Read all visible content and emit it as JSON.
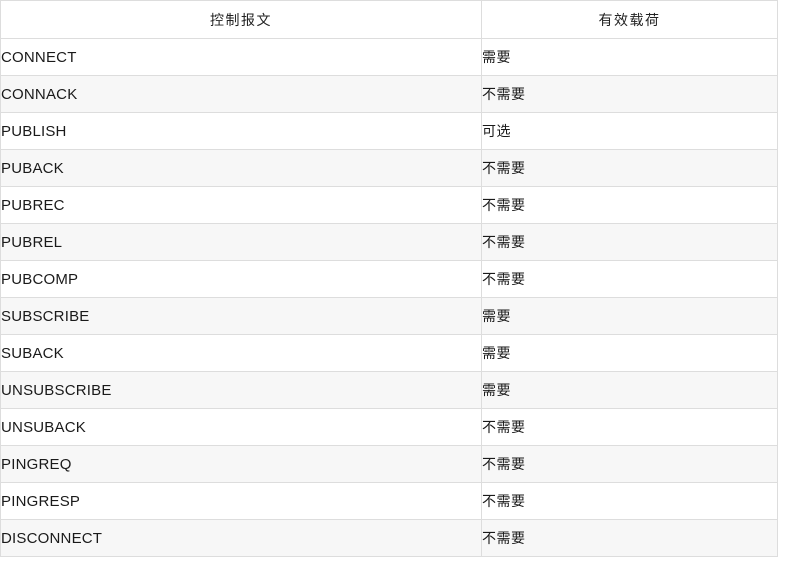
{
  "table": {
    "columns": [
      {
        "key": "message",
        "header": "控制报文",
        "align": "center"
      },
      {
        "key": "payload",
        "header": "有效载荷",
        "align": "center"
      }
    ],
    "rows": [
      {
        "message": "CONNECT",
        "payload": "需要"
      },
      {
        "message": "CONNACK",
        "payload": "不需要"
      },
      {
        "message": "PUBLISH",
        "payload": "可选"
      },
      {
        "message": "PUBACK",
        "payload": "不需要"
      },
      {
        "message": "PUBREC",
        "payload": "不需要"
      },
      {
        "message": "PUBREL",
        "payload": "不需要"
      },
      {
        "message": "PUBCOMP",
        "payload": "不需要"
      },
      {
        "message": "SUBSCRIBE",
        "payload": "需要"
      },
      {
        "message": "SUBACK",
        "payload": "需要"
      },
      {
        "message": "UNSUBSCRIBE",
        "payload": "需要"
      },
      {
        "message": "UNSUBACK",
        "payload": "不需要"
      },
      {
        "message": "PINGREQ",
        "payload": "不需要"
      },
      {
        "message": "PINGRESP",
        "payload": "不需要"
      },
      {
        "message": "DISCONNECT",
        "payload": "不需要"
      }
    ]
  },
  "colors": {
    "border": "#dddddd",
    "row_odd_bg": "#ffffff",
    "row_even_bg": "#f7f7f7",
    "text": "#1c1c1c"
  }
}
